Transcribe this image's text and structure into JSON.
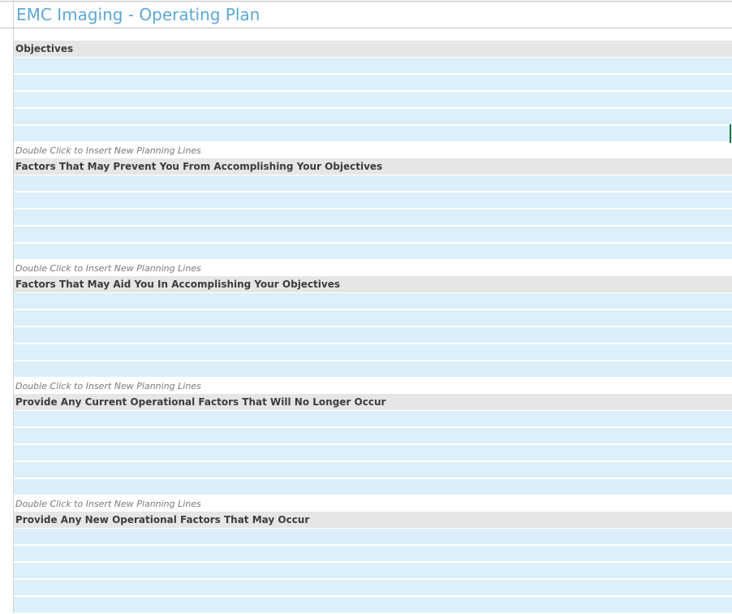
{
  "title": "EMC Imaging - Operating Plan",
  "hint_text": "Double Click to Insert New Planning Lines",
  "sections": [
    {
      "heading": "Objectives",
      "rows": 5
    },
    {
      "heading": "Factors That May Prevent You From Accomplishing Your Objectives",
      "rows": 5
    },
    {
      "heading": "Factors That May Aid You In Accomplishing Your Objectives",
      "rows": 5
    },
    {
      "heading": "Provide Any Current Operational Factors That Will No Longer Occur",
      "rows": 5
    },
    {
      "heading": "Provide Any New Operational Factors That May Occur",
      "rows": 5
    }
  ],
  "colors": {
    "title": "#5ba7d8",
    "header_bg": "#e6e6e6",
    "row_bg": "#dceffa",
    "hint": "#7a7a7a"
  }
}
